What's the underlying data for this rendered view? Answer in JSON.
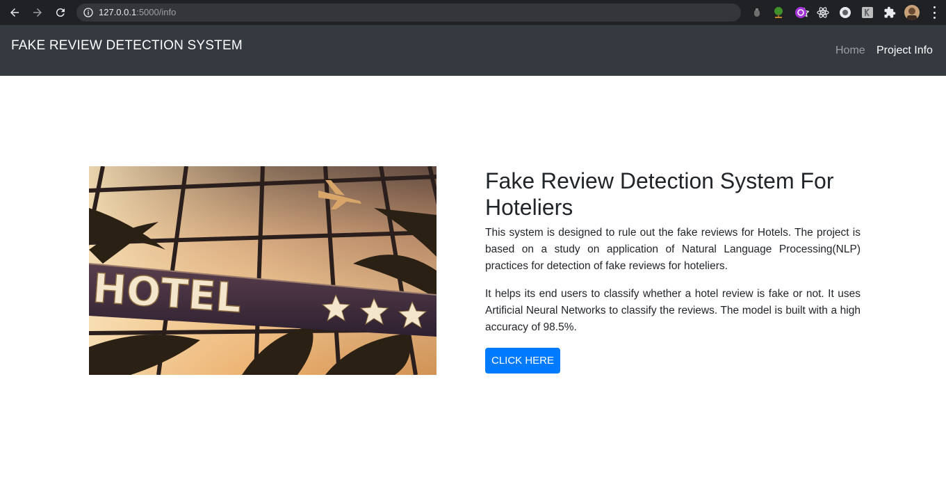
{
  "browser": {
    "url_host": "127.0.0.1",
    "url_path": ":5000/info",
    "icons": [
      "back-icon",
      "forward-icon",
      "reload-icon",
      "info-icon",
      "bookmark-star-icon",
      "extensions-icon",
      "menu-icon"
    ]
  },
  "navbar": {
    "brand": "FAKE REVIEW DETECTION SYSTEM",
    "links": [
      {
        "label": "Home",
        "active": false
      },
      {
        "label": "Project Info",
        "active": true
      }
    ],
    "bg_color": "#343a40"
  },
  "main": {
    "image": {
      "sign_text": "HOTEL",
      "description_icon": "hotel-sign-image"
    },
    "heading": "Fake Review Detection System For Hoteliers",
    "paragraphs": [
      "This system is designed to rule out the fake reviews for Hotels. The project is based on a study on application of Natural Language Processing(NLP) practices for detection of fake reviews for hoteliers.",
      "It helps its end users to classify whether a hotel review is fake or not. It uses Artificial Neural Networks to classify the reviews. The model is built with a high accuracy of 98.5%."
    ],
    "button_label": "CLICK HERE",
    "accent_color": "#007bff"
  }
}
